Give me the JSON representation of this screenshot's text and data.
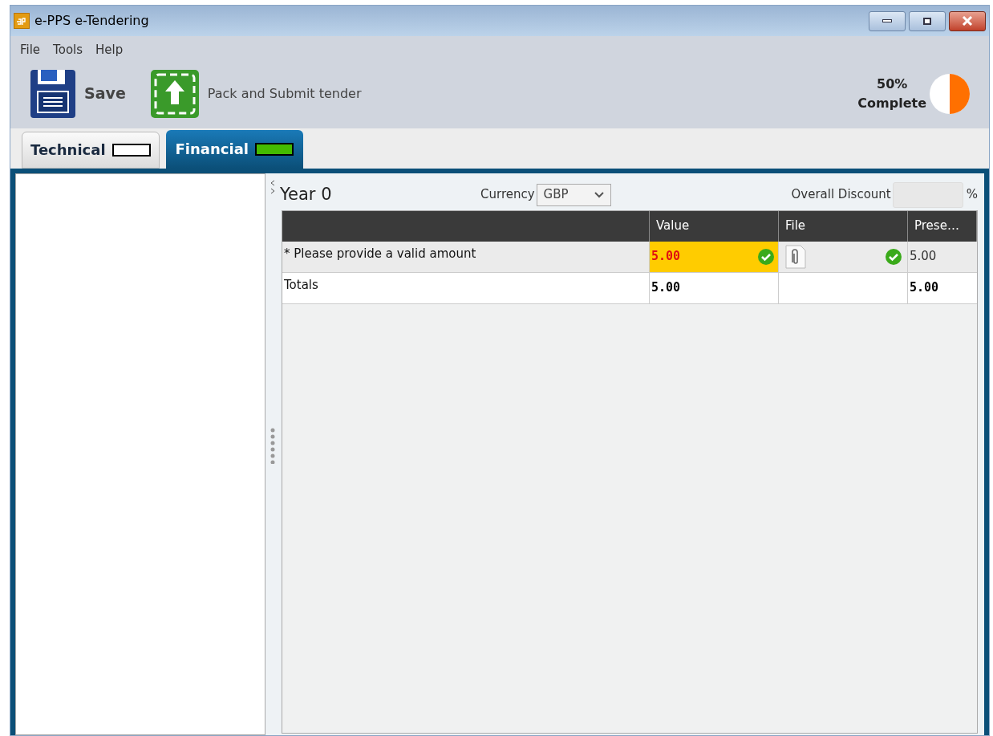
{
  "window": {
    "title": "e-PPS e-Tendering"
  },
  "menu": [
    "File",
    "Tools",
    "Help"
  ],
  "toolbar": [
    {
      "kind": "save",
      "label": "Save"
    },
    {
      "kind": "submit",
      "label": "Pack and Submit tender"
    }
  ],
  "progress": {
    "percent": "50%",
    "label": "Complete",
    "level": 0.5
  },
  "tabs": [
    {
      "label": "Technical",
      "selected": false,
      "color": "#ffffff"
    },
    {
      "label": "Financial",
      "selected": true,
      "color": "#44bb00"
    }
  ],
  "section": {
    "title": "Year 0",
    "currency_label": "Currency",
    "currency": "GBP",
    "discount_label": "Overall Discount",
    "discount_suffix": "%"
  },
  "table": {
    "columns": [
      "Value",
      "File",
      "Prese…"
    ],
    "rows": [
      {
        "kind": "item",
        "label": "* Please provide a valid amount",
        "value": "5.00",
        "highlighted": true,
        "value_valid": true,
        "file_attached": true,
        "file_valid": true,
        "present": "5.00"
      },
      {
        "kind": "totals",
        "label": "Totals",
        "value": "5.00",
        "present": "5.00"
      }
    ]
  }
}
